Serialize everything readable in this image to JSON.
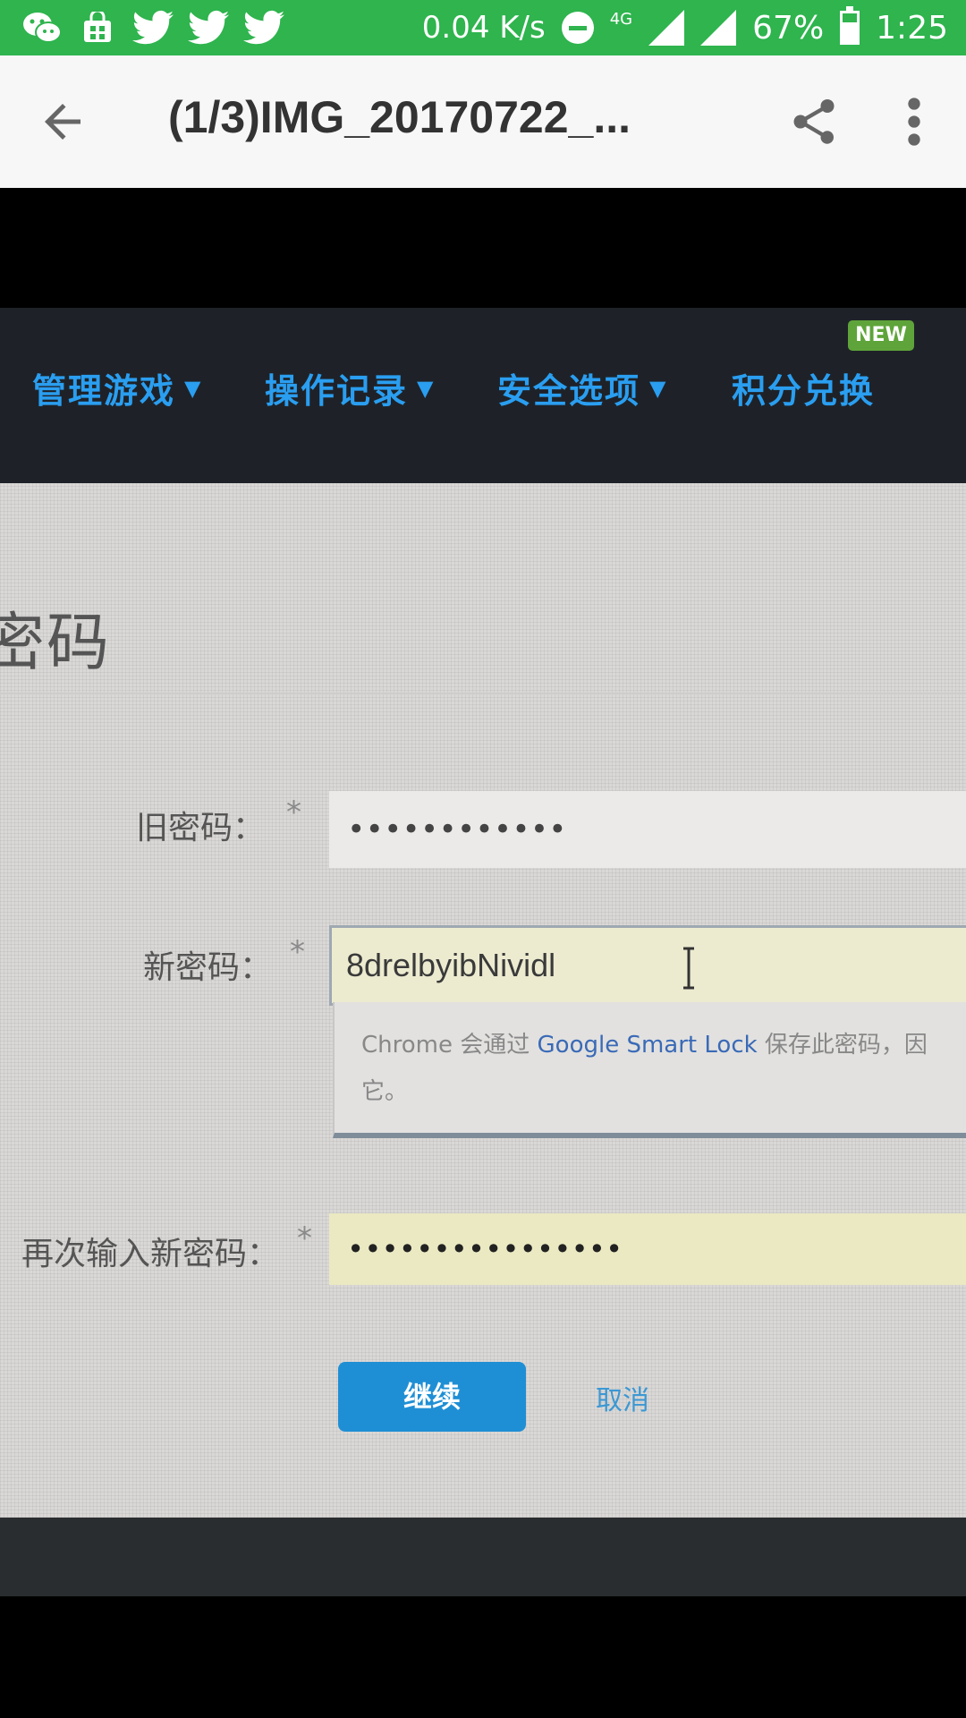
{
  "status_bar": {
    "speed": "0.04 K/s",
    "network": "4G",
    "battery": "67%",
    "time": "1:25",
    "left_icons": [
      "wechat-icon",
      "store-icon",
      "twitter-icon",
      "twitter-icon",
      "twitter-icon"
    ]
  },
  "app_bar": {
    "title": "(1/3)IMG_20170722_..."
  },
  "photo": {
    "nav": {
      "items": [
        "管理游戏",
        "操作记录",
        "安全选项",
        "积分兑换"
      ],
      "badge": "NEW"
    },
    "heading": "密码",
    "form": {
      "old_password_label": "旧密码：",
      "old_password_value": "••••••••••••",
      "new_password_label": "新密码：",
      "new_password_value": "8drelbyibNividl",
      "confirm_label": "再次输入新密码：",
      "confirm_value": "••••••••••••••••",
      "required_mark": "*"
    },
    "smart_lock_popup": {
      "text_before": "Chrome 会通过 ",
      "link": "Google Smart Lock",
      "text_after": " 保存此密码，因",
      "line2": "它。"
    },
    "buttons": {
      "continue": "继续",
      "cancel": "取消"
    }
  },
  "colors": {
    "status_bar": "#2fb44e",
    "nav_text": "#2a9ef0",
    "button_blue": "#1f8fd5"
  }
}
